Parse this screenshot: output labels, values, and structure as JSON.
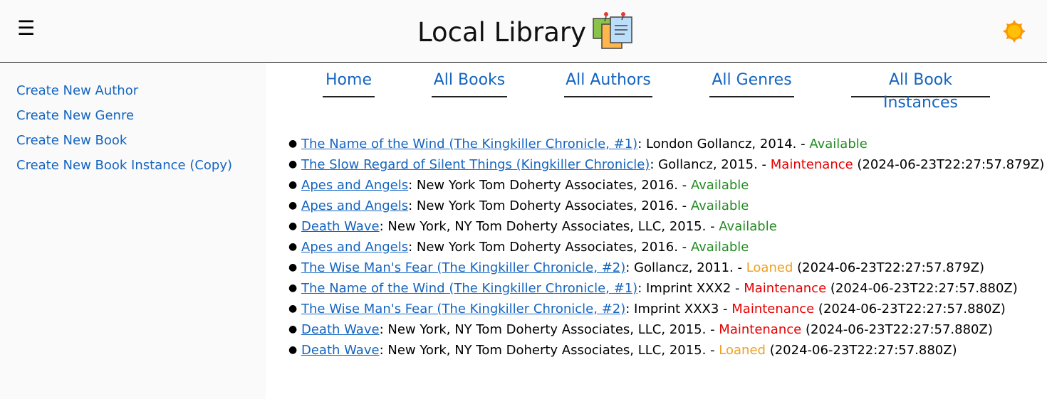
{
  "header": {
    "menu_icon": "hamburger-menu-icon",
    "title": "Local Library",
    "logo_icon": "sticky-notes-logo",
    "theme_icon": "sun-icon"
  },
  "sidebar": {
    "items": [
      {
        "label": "Create New Author"
      },
      {
        "label": "Create New Genre"
      },
      {
        "label": "Create New Book"
      },
      {
        "label": "Create New Book Instance (Copy)"
      }
    ]
  },
  "nav": {
    "items": [
      {
        "label": "Home"
      },
      {
        "label": "All Books"
      },
      {
        "label": "All Authors"
      },
      {
        "label": "All Genres"
      },
      {
        "label": "All Book Instances"
      }
    ]
  },
  "bookinstances": [
    {
      "title": "The Name of the Wind (The Kingkiller Chronicle, #1)",
      "imprint": ": London Gollancz, 2014. - ",
      "status": "Available",
      "due": ""
    },
    {
      "title": "The Slow Regard of Silent Things (Kingkiller Chronicle)",
      "imprint": ": Gollancz, 2015. - ",
      "status": "Maintenance",
      "due": " (2024-06-23T22:27:57.879Z)"
    },
    {
      "title": "Apes and Angels",
      "imprint": ": New York Tom Doherty Associates, 2016. - ",
      "status": "Available",
      "due": ""
    },
    {
      "title": "Apes and Angels",
      "imprint": ": New York Tom Doherty Associates, 2016. - ",
      "status": "Available",
      "due": ""
    },
    {
      "title": "Death Wave",
      "imprint": ": New York, NY Tom Doherty Associates, LLC, 2015. - ",
      "status": "Available",
      "due": ""
    },
    {
      "title": "Apes and Angels",
      "imprint": ": New York Tom Doherty Associates, 2016. - ",
      "status": "Available",
      "due": ""
    },
    {
      "title": "The Wise Man's Fear (The Kingkiller Chronicle, #2)",
      "imprint": ": Gollancz, 2011. - ",
      "status": "Loaned",
      "due": " (2024-06-23T22:27:57.879Z)"
    },
    {
      "title": "The Name of the Wind (The Kingkiller Chronicle, #1)",
      "imprint": ": Imprint XXX2 - ",
      "status": "Maintenance",
      "due": " (2024-06-23T22:27:57.880Z)"
    },
    {
      "title": "The Wise Man's Fear (The Kingkiller Chronicle, #2)",
      "imprint": ": Imprint XXX3 - ",
      "status": "Maintenance",
      "due": " (2024-06-23T22:27:57.880Z)"
    },
    {
      "title": "Death Wave",
      "imprint": ": New York, NY Tom Doherty Associates, LLC, 2015. - ",
      "status": "Maintenance",
      "due": " (2024-06-23T22:27:57.880Z)"
    },
    {
      "title": "Death Wave",
      "imprint": ": New York, NY Tom Doherty Associates, LLC, 2015. - ",
      "status": "Loaned",
      "due": " (2024-06-23T22:27:57.880Z)"
    }
  ],
  "colors": {
    "link": "#1565c0",
    "available": "#228b22",
    "maintenance": "#e60000",
    "loaned": "#f0a020"
  }
}
